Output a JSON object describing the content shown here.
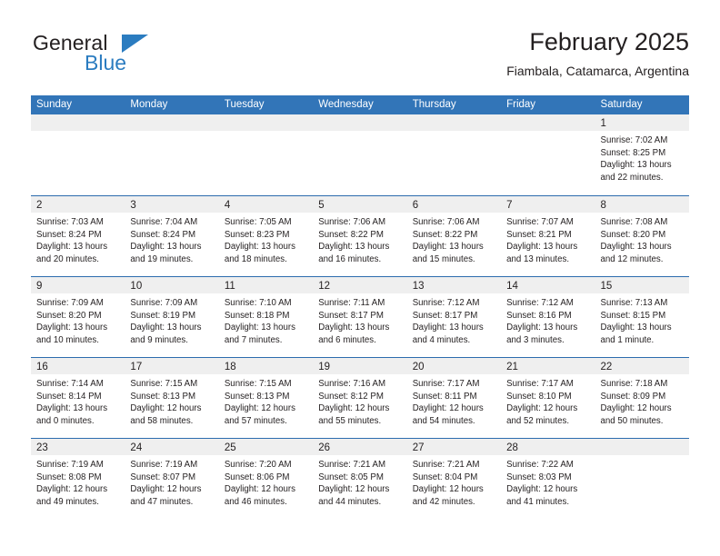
{
  "brand": {
    "name_top": "General",
    "name_bottom": "Blue",
    "triangle_icon": "blue-triangle-logo",
    "color_black": "#231f20",
    "color_blue": "#2b7cc0"
  },
  "header": {
    "title": "February 2025",
    "subtitle": "Fiambala, Catamarca, Argentina"
  },
  "theme": {
    "header_blue": "#3275b8",
    "rule_blue": "#2c6cae",
    "daynum_band": "#efefef",
    "text": "#231f20"
  },
  "calendar": {
    "weekday_headers": [
      "Sunday",
      "Monday",
      "Tuesday",
      "Wednesday",
      "Thursday",
      "Friday",
      "Saturday"
    ],
    "weeks": [
      [
        {
          "day": "",
          "empty": true
        },
        {
          "day": "",
          "empty": true
        },
        {
          "day": "",
          "empty": true
        },
        {
          "day": "",
          "empty": true
        },
        {
          "day": "",
          "empty": true
        },
        {
          "day": "",
          "empty": true
        },
        {
          "day": "1",
          "sunrise": "Sunrise: 7:02 AM",
          "sunset": "Sunset: 8:25 PM",
          "daylight": "Daylight: 13 hours and 22 minutes."
        }
      ],
      [
        {
          "day": "2",
          "sunrise": "Sunrise: 7:03 AM",
          "sunset": "Sunset: 8:24 PM",
          "daylight": "Daylight: 13 hours and 20 minutes."
        },
        {
          "day": "3",
          "sunrise": "Sunrise: 7:04 AM",
          "sunset": "Sunset: 8:24 PM",
          "daylight": "Daylight: 13 hours and 19 minutes."
        },
        {
          "day": "4",
          "sunrise": "Sunrise: 7:05 AM",
          "sunset": "Sunset: 8:23 PM",
          "daylight": "Daylight: 13 hours and 18 minutes."
        },
        {
          "day": "5",
          "sunrise": "Sunrise: 7:06 AM",
          "sunset": "Sunset: 8:22 PM",
          "daylight": "Daylight: 13 hours and 16 minutes."
        },
        {
          "day": "6",
          "sunrise": "Sunrise: 7:06 AM",
          "sunset": "Sunset: 8:22 PM",
          "daylight": "Daylight: 13 hours and 15 minutes."
        },
        {
          "day": "7",
          "sunrise": "Sunrise: 7:07 AM",
          "sunset": "Sunset: 8:21 PM",
          "daylight": "Daylight: 13 hours and 13 minutes."
        },
        {
          "day": "8",
          "sunrise": "Sunrise: 7:08 AM",
          "sunset": "Sunset: 8:20 PM",
          "daylight": "Daylight: 13 hours and 12 minutes."
        }
      ],
      [
        {
          "day": "9",
          "sunrise": "Sunrise: 7:09 AM",
          "sunset": "Sunset: 8:20 PM",
          "daylight": "Daylight: 13 hours and 10 minutes."
        },
        {
          "day": "10",
          "sunrise": "Sunrise: 7:09 AM",
          "sunset": "Sunset: 8:19 PM",
          "daylight": "Daylight: 13 hours and 9 minutes."
        },
        {
          "day": "11",
          "sunrise": "Sunrise: 7:10 AM",
          "sunset": "Sunset: 8:18 PM",
          "daylight": "Daylight: 13 hours and 7 minutes."
        },
        {
          "day": "12",
          "sunrise": "Sunrise: 7:11 AM",
          "sunset": "Sunset: 8:17 PM",
          "daylight": "Daylight: 13 hours and 6 minutes."
        },
        {
          "day": "13",
          "sunrise": "Sunrise: 7:12 AM",
          "sunset": "Sunset: 8:17 PM",
          "daylight": "Daylight: 13 hours and 4 minutes."
        },
        {
          "day": "14",
          "sunrise": "Sunrise: 7:12 AM",
          "sunset": "Sunset: 8:16 PM",
          "daylight": "Daylight: 13 hours and 3 minutes."
        },
        {
          "day": "15",
          "sunrise": "Sunrise: 7:13 AM",
          "sunset": "Sunset: 8:15 PM",
          "daylight": "Daylight: 13 hours and 1 minute."
        }
      ],
      [
        {
          "day": "16",
          "sunrise": "Sunrise: 7:14 AM",
          "sunset": "Sunset: 8:14 PM",
          "daylight": "Daylight: 13 hours and 0 minutes."
        },
        {
          "day": "17",
          "sunrise": "Sunrise: 7:15 AM",
          "sunset": "Sunset: 8:13 PM",
          "daylight": "Daylight: 12 hours and 58 minutes."
        },
        {
          "day": "18",
          "sunrise": "Sunrise: 7:15 AM",
          "sunset": "Sunset: 8:13 PM",
          "daylight": "Daylight: 12 hours and 57 minutes."
        },
        {
          "day": "19",
          "sunrise": "Sunrise: 7:16 AM",
          "sunset": "Sunset: 8:12 PM",
          "daylight": "Daylight: 12 hours and 55 minutes."
        },
        {
          "day": "20",
          "sunrise": "Sunrise: 7:17 AM",
          "sunset": "Sunset: 8:11 PM",
          "daylight": "Daylight: 12 hours and 54 minutes."
        },
        {
          "day": "21",
          "sunrise": "Sunrise: 7:17 AM",
          "sunset": "Sunset: 8:10 PM",
          "daylight": "Daylight: 12 hours and 52 minutes."
        },
        {
          "day": "22",
          "sunrise": "Sunrise: 7:18 AM",
          "sunset": "Sunset: 8:09 PM",
          "daylight": "Daylight: 12 hours and 50 minutes."
        }
      ],
      [
        {
          "day": "23",
          "sunrise": "Sunrise: 7:19 AM",
          "sunset": "Sunset: 8:08 PM",
          "daylight": "Daylight: 12 hours and 49 minutes."
        },
        {
          "day": "24",
          "sunrise": "Sunrise: 7:19 AM",
          "sunset": "Sunset: 8:07 PM",
          "daylight": "Daylight: 12 hours and 47 minutes."
        },
        {
          "day": "25",
          "sunrise": "Sunrise: 7:20 AM",
          "sunset": "Sunset: 8:06 PM",
          "daylight": "Daylight: 12 hours and 46 minutes."
        },
        {
          "day": "26",
          "sunrise": "Sunrise: 7:21 AM",
          "sunset": "Sunset: 8:05 PM",
          "daylight": "Daylight: 12 hours and 44 minutes."
        },
        {
          "day": "27",
          "sunrise": "Sunrise: 7:21 AM",
          "sunset": "Sunset: 8:04 PM",
          "daylight": "Daylight: 12 hours and 42 minutes."
        },
        {
          "day": "28",
          "sunrise": "Sunrise: 7:22 AM",
          "sunset": "Sunset: 8:03 PM",
          "daylight": "Daylight: 12 hours and 41 minutes."
        },
        {
          "day": "",
          "empty": true
        }
      ]
    ]
  }
}
